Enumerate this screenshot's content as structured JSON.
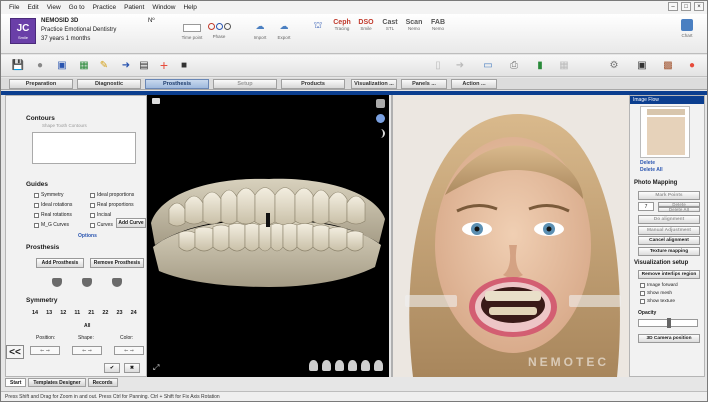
{
  "menu": [
    "File",
    "Edit",
    "View",
    "Go to",
    "Practice",
    "Patient",
    "Window",
    "Help"
  ],
  "patient": {
    "initials": "JC",
    "badge_small": "Smile",
    "app_name": "NEMOSID 3D",
    "practice": "Practice Emotional Dentistry",
    "age": "37 years 1 months",
    "number_label": "Nº"
  },
  "header_icons": [
    {
      "name": "time-point-icon",
      "label": "Time point"
    },
    {
      "name": "phase-icon",
      "label": "Phase"
    },
    {
      "name": "import-icon",
      "label": "Import"
    },
    {
      "name": "export-icon",
      "label": "Export"
    },
    {
      "name": "tooth-icon",
      "label": ""
    },
    {
      "name": "ceph-icon",
      "label": "Ceph",
      "sub": "Tracing"
    },
    {
      "name": "dso-icon",
      "label": "DSO",
      "sub": "Smile"
    },
    {
      "name": "cast-icon",
      "label": "Cast",
      "sub": "STL"
    },
    {
      "name": "scan-icon",
      "label": "Scan",
      "sub": "Nemo"
    },
    {
      "name": "fab-icon",
      "label": "FAB",
      "sub": "Nemo"
    },
    {
      "name": "chart-icon",
      "label": "Chart"
    }
  ],
  "tabs": {
    "preparation": "Preparation",
    "diagnostic": "Diagnostic",
    "prosthesis": "Prosthesis",
    "setup": "Setup",
    "products": "Products",
    "visualization": "Visualization ...",
    "panels": "Panels ...",
    "action": "Action ..."
  },
  "left": {
    "contours_title": "Contours",
    "contours_placeholder": "Shape Tooth Contours",
    "guides_title": "Guides",
    "guides_col1": [
      "Symmetry",
      "Ideal rotations",
      "Real rotations",
      "M_G Curves"
    ],
    "guides_col2": [
      "Ideal proportions",
      "Real proportions",
      "Incisal",
      "Curves"
    ],
    "add_curve": "Add Curve",
    "options": "Options",
    "prosthesis_title": "Prosthesis",
    "add_prosthesis": "Add Prosthesis",
    "remove_prosthesis": "Remove Prosthesis",
    "symmetry_title": "Symmetry",
    "teeth": [
      "14",
      "13",
      "12",
      "11",
      "21",
      "22",
      "23",
      "24"
    ],
    "all_label": "All",
    "position_label": "Position:",
    "shape_label": "Shape:",
    "color_label": "Color:",
    "collapse_label": "<<"
  },
  "right": {
    "image_flow": "Image Flow",
    "delete": "Delete",
    "delete_all": "Delete All",
    "photo_mapping": "Photo Mapping",
    "mark_points": "Mark Points",
    "delete_btn": "Delete",
    "delete_all_btn": "Delete All",
    "do_alignment": "Do alignment",
    "manual_adjustment": "Manual Adjustment",
    "cancel_alignment": "Cancel alignment",
    "texture_mapping": "Texture mapping",
    "spin_value": "7",
    "visualization_setup": "Visualization setup",
    "remove_interlips": "Remove interlips region",
    "image_forward": "Image forward",
    "show_mesh": "Show mesh",
    "show_texture": "Show texture",
    "opacity": "Opacity",
    "camera_position": "3D Camera position"
  },
  "watermark": "NEMOTEC",
  "bottom_tabs": [
    "Start",
    "Templates Designer",
    "Records"
  ],
  "status": "Press Shift and Drag for Zoom in and out. Press Ctrl for Panning. Ctrl + Shift for Fix Axis Rotation"
}
